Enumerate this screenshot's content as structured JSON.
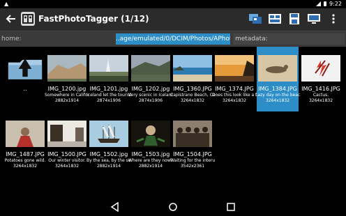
{
  "status": {
    "time": "9:22"
  },
  "appbar": {
    "title": "FastPhotoTagger (1/12)"
  },
  "path": {
    "home_label": "home:",
    "path_label": "..age/emulated/0/DCIM/Photos/APhotos/",
    "meta_label": "metadata:"
  },
  "grid": {
    "parent_label": "..",
    "items": [
      {
        "name": "IMG_1200.jpg",
        "desc": "Somewhere in Californi",
        "size": "2882x1914"
      },
      {
        "name": "IMG_1201.jpg",
        "desc": "Iceland let the tourists",
        "size": "2874x1906"
      },
      {
        "name": "IMG_1202.jpg",
        "desc": "Very scenic in Iceland.",
        "size": "2874x1906"
      },
      {
        "name": "IMG_1360.JPG",
        "desc": "Capistrano Beach, Cali",
        "size": "3264x1832"
      },
      {
        "name": "IMG_1374.JPG",
        "desc": "Does this look like a f",
        "size": "3264x1832"
      },
      {
        "name": "IMG_1384.JPG",
        "desc": "Lazy day on the beach",
        "size": "3264x1832"
      },
      {
        "name": "IMG_1416.JPG",
        "desc": "Cactus.",
        "size": "3264x1832"
      },
      {
        "name": "IMG_1487.JPG",
        "desc": "Potatoes gone wild.",
        "size": "3264x1832"
      },
      {
        "name": "IMG_1500.JPG",
        "desc": "Our winter visitor.",
        "size": "3264x1832"
      },
      {
        "name": "IMG_1502.jpg",
        "desc": "By the sea, by the sea.",
        "size": "2882x1914"
      },
      {
        "name": "IMG_1503.jpg",
        "desc": "Where are they now?",
        "size": "2882x1914"
      },
      {
        "name": "IMG_1504.JPG",
        "desc": "Waiting for the interurb",
        "size": "3542x2361"
      }
    ]
  },
  "colors": {
    "accent": "#2c8dc7",
    "actionbar": "#2b2b2b",
    "pathbar": "#3a3a3a"
  }
}
